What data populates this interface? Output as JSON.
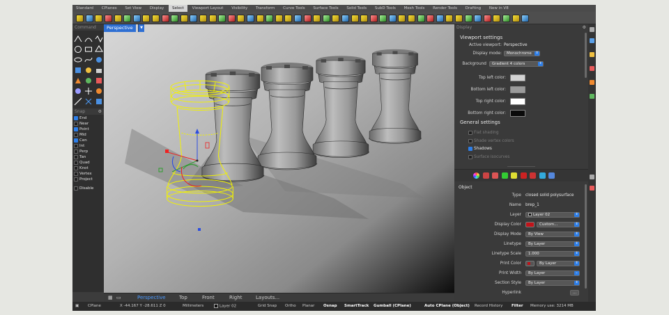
{
  "menu_tabs": [
    "Standard",
    "CPlanes",
    "Set View",
    "Display",
    "Select",
    "Viewport Layout",
    "Visibility",
    "Transform",
    "Curve Tools",
    "Surface Tools",
    "Solid Tools",
    "SubD Tools",
    "Mesh Tools",
    "Render Tools",
    "Drafting",
    "New in V8"
  ],
  "active_menu_tab": "Select",
  "left_panels": {
    "command_title": "Command",
    "snap_title": "Snap",
    "osnaps": [
      {
        "label": "End",
        "checked": true
      },
      {
        "label": "Near",
        "checked": false
      },
      {
        "label": "Point",
        "checked": true
      },
      {
        "label": "Mid",
        "checked": false
      },
      {
        "label": "Cen",
        "checked": true
      },
      {
        "label": "Int",
        "checked": false
      },
      {
        "label": "Perp",
        "checked": false
      },
      {
        "label": "Tan",
        "checked": false
      },
      {
        "label": "Quad",
        "checked": false
      },
      {
        "label": "Knot",
        "checked": false
      },
      {
        "label": "Vertex",
        "checked": false
      },
      {
        "label": "Project",
        "checked": false
      },
      {
        "label": "Disable",
        "checked": false
      }
    ]
  },
  "viewport": {
    "title": "Perspective",
    "bottom_tabs": [
      "Perspective",
      "Top",
      "Front",
      "Right",
      "Layouts..."
    ],
    "active_bottom_tab": "Perspective"
  },
  "display_panel": {
    "panel_title": "Display",
    "viewport_settings_title": "Viewport settings",
    "active_viewport_label": "Active viewport:",
    "active_viewport_value": "Perspective",
    "display_mode_label": "Display mode:",
    "display_mode_value": "Monochrome",
    "background_label": "Background",
    "background_value": "Gradient 4 colors",
    "gradient_colors": [
      {
        "label": "Top left color:",
        "color": "#d3d3d3"
      },
      {
        "label": "Bottom left color:",
        "color": "#9b9b9b"
      },
      {
        "label": "Top right color:",
        "color": "#ffffff"
      },
      {
        "label": "Bottom right color:",
        "color": "#0a0a0a"
      }
    ],
    "general_settings_title": "General settings",
    "general_options": [
      {
        "label": "Flat shading",
        "checked": false,
        "enabled": false
      },
      {
        "label": "Shade vertex colors",
        "checked": false,
        "enabled": false
      },
      {
        "label": "Shadows",
        "checked": true,
        "enabled": true
      },
      {
        "label": "Surface isocurves",
        "checked": false,
        "enabled": false
      }
    ]
  },
  "properties_panel": {
    "section_title": "Object",
    "rows": [
      {
        "label": "Type",
        "value": "closed solid polysurface",
        "kind": "text"
      },
      {
        "label": "Name",
        "value": "brep_1",
        "kind": "text"
      },
      {
        "label": "Layer",
        "value": "Layer 02",
        "kind": "select"
      },
      {
        "label": "Display Color",
        "value": "Custom...",
        "kind": "select"
      },
      {
        "label": "Display Mode",
        "value": "By View",
        "kind": "select"
      },
      {
        "label": "Linetype",
        "value": "By Layer",
        "kind": "select"
      },
      {
        "label": "Linetype Scale",
        "value": "1.000",
        "kind": "select"
      },
      {
        "label": "Print Color",
        "value": "By Layer",
        "kind": "select"
      },
      {
        "label": "Print Width",
        "value": "By Layer",
        "kind": "select"
      },
      {
        "label": "Section Style",
        "value": "By Layer",
        "kind": "select"
      },
      {
        "label": "Hyperlink",
        "value": "...",
        "kind": "button"
      }
    ],
    "display_color": "#c0141a",
    "print_color": "#c0141a"
  },
  "status_bar": {
    "cplane": "CPlane",
    "coords": "X -44.167 Y -28.611 Z 0",
    "units": "Millimeters",
    "layer": "Layer 02",
    "toggles": [
      {
        "label": "Grid Snap",
        "on": false
      },
      {
        "label": "Ortho",
        "on": false
      },
      {
        "label": "Planar",
        "on": false
      },
      {
        "label": "Osnap",
        "on": true
      },
      {
        "label": "SmartTrack",
        "on": true
      },
      {
        "label": "Gumball (CPlane)",
        "on": true
      },
      {
        "label": "Auto CPlane (Object)",
        "on": true
      },
      {
        "label": "Record History",
        "on": false
      },
      {
        "label": "Filter",
        "on": true
      }
    ],
    "memory": "Memory use: 3214 MB"
  },
  "colors": {
    "accent": "#2e6fd3",
    "selection": "#f2f200"
  }
}
